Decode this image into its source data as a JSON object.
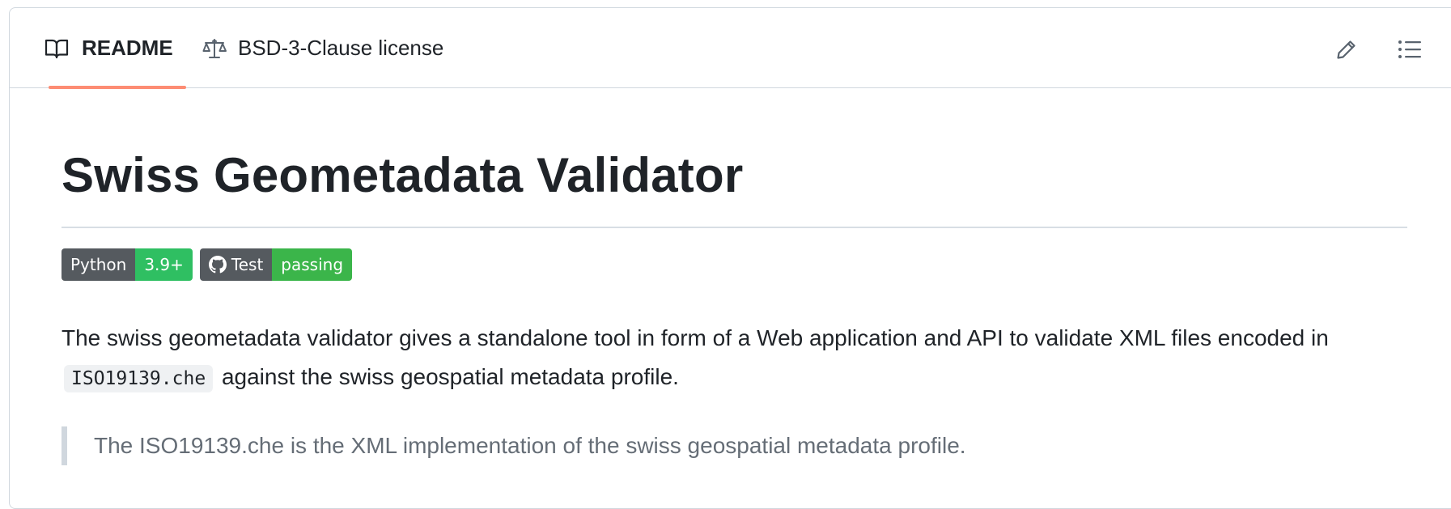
{
  "tabs": {
    "readme": {
      "label": "README",
      "icon": "book-icon",
      "active": true
    },
    "license": {
      "label": "BSD-3-Clause license",
      "icon": "scale-icon"
    }
  },
  "toolbar": {
    "edit_icon": "pencil-icon",
    "toc_icon": "list-icon"
  },
  "readme": {
    "title": "Swiss Geometadata Validator",
    "badges": [
      {
        "left": "Python",
        "right": "3.9+",
        "right_color": "#2fbf62"
      },
      {
        "left": "Test",
        "right": "passing",
        "right_color": "#3bb54a",
        "icon": "github-icon"
      }
    ],
    "paragraph": {
      "before": "The swiss geometadata validator gives a standalone tool in form of a Web application and API to validate XML files encoded in",
      "code": "ISO19139.che",
      "after": "against the swiss geospatial metadata profile."
    },
    "blockquote": "The ISO19139.che is the XML implementation of the swiss geospatial metadata profile."
  },
  "colors": {
    "accent_underline": "#fd8c73",
    "border": "#d0d7de",
    "muted_text": "#656d76"
  }
}
